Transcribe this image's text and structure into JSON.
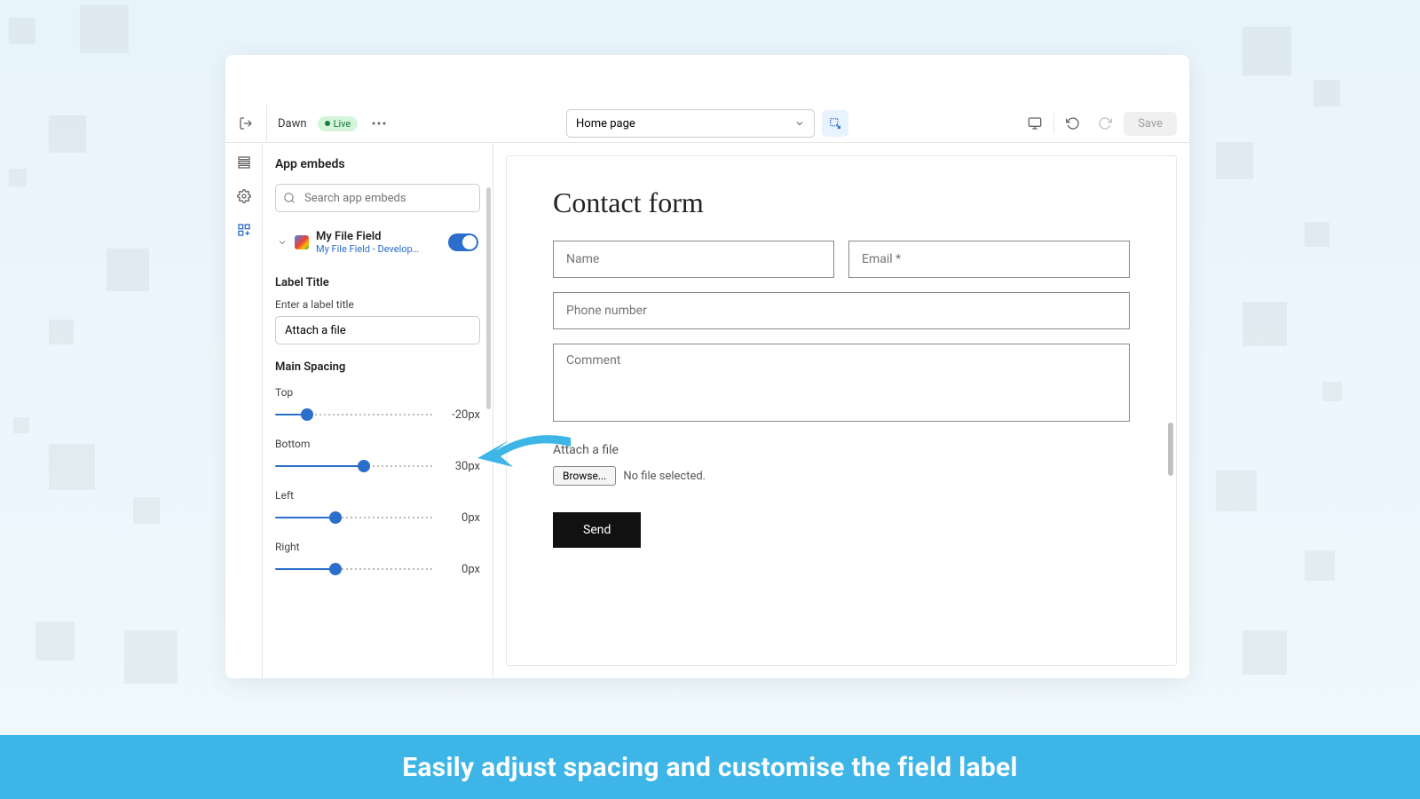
{
  "topbar": {
    "theme_name": "Dawn",
    "live_label": "Live",
    "page_select": "Home page",
    "save_label": "Save"
  },
  "panel": {
    "title": "App embeds",
    "search_placeholder": "Search app embeds",
    "embed": {
      "title": "My File Field",
      "subtitle": "My File Field - Develop…"
    },
    "label_section": "Label Title",
    "label_help": "Enter a label title",
    "label_value": "Attach a file",
    "spacing_section": "Main Spacing",
    "sliders": {
      "top": {
        "label": "Top",
        "value": "-20px",
        "pct": 20
      },
      "bottom": {
        "label": "Bottom",
        "value": "30px",
        "pct": 56
      },
      "left": {
        "label": "Left",
        "value": "0px",
        "pct": 38
      },
      "right": {
        "label": "Right",
        "value": "0px",
        "pct": 38
      }
    }
  },
  "form": {
    "heading": "Contact form",
    "name_ph": "Name",
    "email_ph": "Email *",
    "phone_ph": "Phone number",
    "comment_ph": "Comment",
    "attach_label": "Attach a file",
    "browse_label": "Browse...",
    "file_status": "No file selected.",
    "send_label": "Send"
  },
  "caption": "Easily adjust spacing and customise the field label"
}
